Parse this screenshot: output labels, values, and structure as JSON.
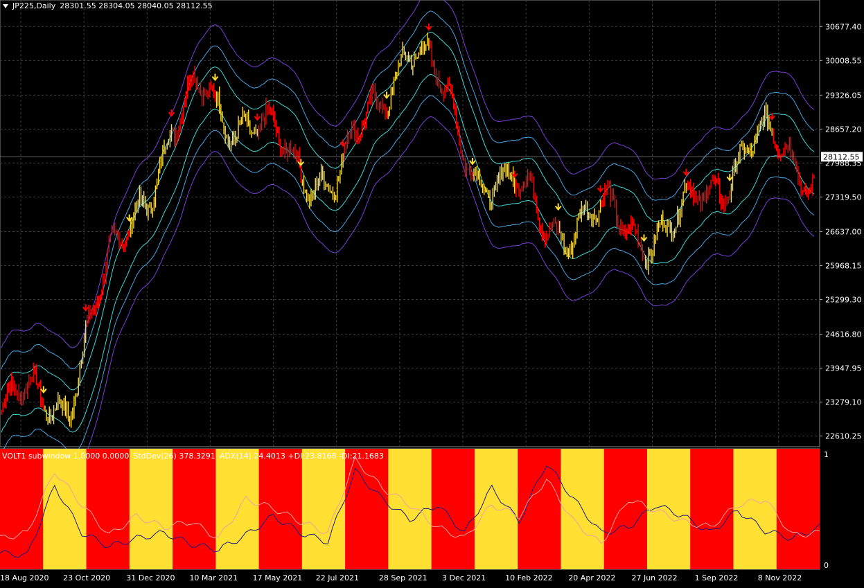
{
  "header": {
    "symbol": "JP225,Daily",
    "ohlc": "28301.55 28304.05 28040.05 28112.55"
  },
  "subwindow": {
    "indicator": "VOLT1 subwindow 1.0000 0.0000",
    "stddev": "StdDev(26) 378.3291",
    "adx": "ADX(14) 24.4013 +DI:23.8168 -DI:21.1683",
    "scale_top": "1",
    "scale_bottom": "0"
  },
  "colors": {
    "background": "#000000",
    "grid": "#3c3c3c",
    "bull": "#ff0000",
    "range": "#ffe033",
    "band_inner": "#40d8d8",
    "band_mid": "#4aa3e0",
    "band_outer": "#7a3fd8",
    "stddev_line": "#1a1a7a",
    "adx_line": "#f0a0a0",
    "price_tag_bg": "#ffffff",
    "price_tag_fg": "#000000"
  },
  "chart_data": [
    {
      "type": "candlestick",
      "title": "JP225,Daily",
      "price_axis_labels": [
        "30677.40",
        "30008.55",
        "29326.05",
        "28657.20",
        "27988.35",
        "27319.50",
        "26637.00",
        "25968.15",
        "25299.30",
        "24616.80",
        "23947.95",
        "23279.10",
        "22610.25"
      ],
      "date_axis_labels": [
        "18 Aug 2020",
        "23 Oct 2020",
        "31 Dec 2020",
        "10 Mar 2021",
        "17 May 2021",
        "22 Jul 2021",
        "28 Sep 2021",
        "3 Dec 2021",
        "10 Feb 2022",
        "20 Apr 2022",
        "27 Jun 2022",
        "1 Sep 2022",
        "8 Nov 2022"
      ],
      "current_price": "28112.55",
      "ylim": [
        22400,
        31200
      ],
      "grid": true,
      "close_series": {
        "x": [
          "18 Aug 2020",
          "23 Oct 2020",
          "31 Dec 2020",
          "10 Mar 2021",
          "17 May 2021",
          "22 Jul 2021",
          "28 Sep 2021",
          "3 Dec 2021",
          "10 Feb 2022",
          "20 Apr 2022",
          "27 Jun 2022",
          "1 Sep 2022",
          "8 Nov 2022"
        ],
        "values": [
          23100,
          23500,
          27300,
          29500,
          28300,
          27600,
          30500,
          28000,
          26900,
          26800,
          26700,
          28400,
          27900
        ]
      },
      "regimes": [
        "red",
        "yellow",
        "red",
        "yellow",
        "red",
        "yellow",
        "red",
        "yellow",
        "red",
        "yellow",
        "red",
        "yellow",
        "red",
        "yellow",
        "red",
        "yellow",
        "red",
        "yellow",
        "red"
      ],
      "bands": [
        "outer upper",
        "mid upper",
        "inner upper",
        "inner lower",
        "mid lower",
        "outer lower"
      ]
    },
    {
      "type": "line",
      "title": "VOLT1 subwindow 1.0000 0.0000",
      "ylim": [
        0,
        1
      ],
      "series": [
        {
          "name": "StdDev(26)",
          "values": [
            0.12,
            0.1,
            0.72,
            0.3,
            0.18,
            0.25,
            0.3,
            0.2,
            0.15,
            0.28,
            0.45,
            0.3,
            0.22,
            0.85,
            0.6,
            0.42,
            0.55,
            0.3,
            0.7,
            0.4,
            0.92,
            0.6,
            0.3,
            0.35,
            0.55,
            0.45,
            0.3,
            0.5,
            0.32,
            0.25,
            0.35
          ]
        },
        {
          "name": "ADX(14)",
          "values": [
            0.25,
            0.3,
            0.85,
            0.55,
            0.28,
            0.45,
            0.35,
            0.4,
            0.25,
            0.6,
            0.52,
            0.4,
            0.3,
            0.95,
            0.7,
            0.55,
            0.35,
            0.25,
            0.55,
            0.45,
            0.78,
            0.4,
            0.2,
            0.6,
            0.5,
            0.4,
            0.35,
            0.55,
            0.6,
            0.28,
            0.3
          ]
        }
      ],
      "regime_blocks": [
        "red",
        "yellow",
        "red",
        "yellow",
        "red",
        "yellow",
        "red",
        "yellow",
        "red",
        "yellow",
        "red",
        "yellow",
        "red",
        "yellow",
        "red",
        "yellow",
        "red",
        "yellow",
        "red"
      ]
    }
  ]
}
